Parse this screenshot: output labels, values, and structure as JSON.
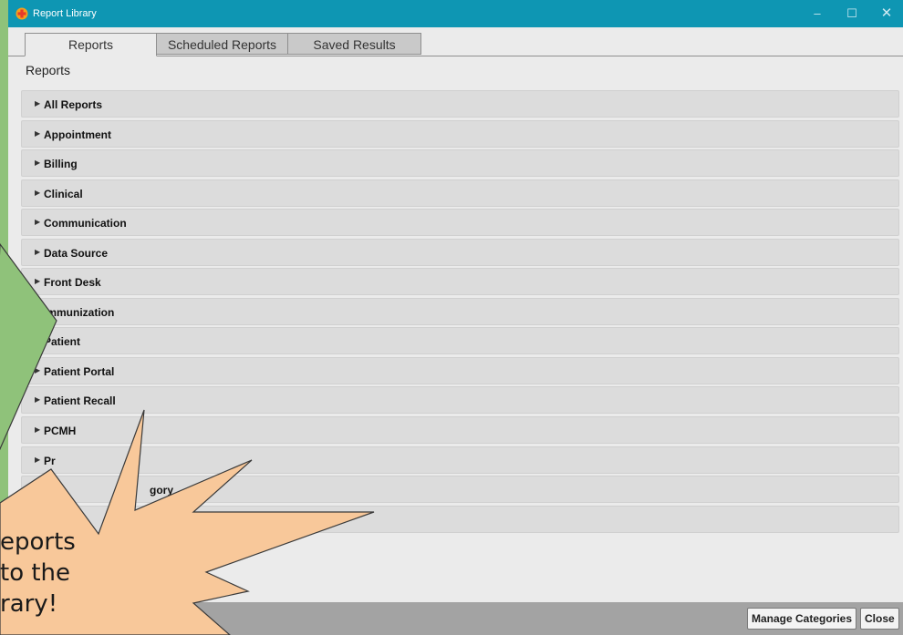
{
  "window": {
    "title": "Report Library",
    "minimize": "–",
    "maximize": "☐",
    "close": "✕"
  },
  "tabs": [
    {
      "label": "Reports"
    },
    {
      "label": "Scheduled Reports"
    },
    {
      "label": "Saved Results"
    }
  ],
  "section_title": "Reports",
  "categories": [
    "All Reports",
    "Appointment",
    "Billing",
    "Clinical",
    "Communication",
    "Data Source",
    "Front Desk",
    "Immunization",
    "Patient",
    "Patient Portal",
    "Patient Recall",
    "PCMH",
    "Pr",
    "gory",
    ""
  ],
  "callout": {
    "lines": [
      "eports",
      "to the",
      "rary!"
    ]
  },
  "footer": {
    "manage": "Manage Categories",
    "close": "Close"
  },
  "colors": {
    "titlebar": "#0e96b3",
    "callout_fill": "#f8c89a",
    "arrow_fill": "#8fc27a"
  }
}
